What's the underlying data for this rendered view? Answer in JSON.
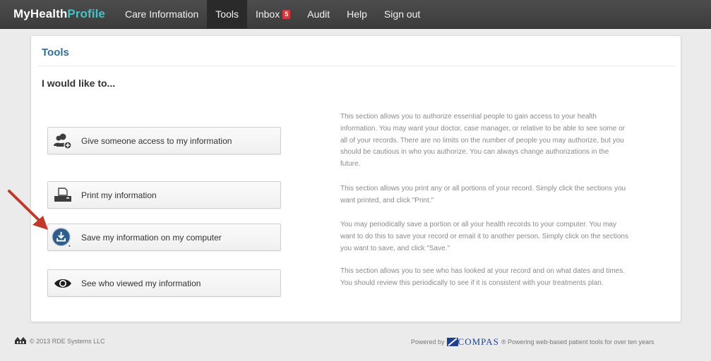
{
  "navbar": {
    "brand_main": "MyHealth",
    "brand_accent": "Profile",
    "items": [
      {
        "label": "Care Information"
      },
      {
        "label": "Tools",
        "active": true
      },
      {
        "label": "Inbox",
        "badge": "5"
      },
      {
        "label": "Audit"
      },
      {
        "label": "Help"
      },
      {
        "label": "Sign out"
      }
    ]
  },
  "panel": {
    "title": "Tools",
    "subheading": "I would like to..."
  },
  "actions": [
    {
      "label": "Give someone access to my information",
      "icon": "add-user-icon",
      "description": "This section allows you to authorize essential people to gain access to your health information. You may want your doctor, case manager, or relative to be able to see some or all of your records. There are no limits on the number of people you may authorize, but you should be cautious in who you authorize. You can always change authorizations in the future."
    },
    {
      "label": "Print my information",
      "icon": "printer-icon",
      "description": "This section allows you print any or all portions of your record. Simply click the sections you want printed, and click \"Print.\""
    },
    {
      "label": "Save my information on my computer",
      "icon": "download-icon",
      "description": "You may periodically save a portion or all your health records to your computer. You may want to do this to save your record or email it to another person. Simply click on the sections you want to save, and click \"Save.\""
    },
    {
      "label": "See who viewed my information",
      "icon": "eye-icon",
      "description": "This section allows you to see who has looked at your record and on what dates and times. You should review this periodically to see if it is consistent with your treatments plan."
    }
  ],
  "footer": {
    "copyright": "© 2013 RDE Systems LLC",
    "powered_by": "Powered by",
    "compas": "COMPAS",
    "tagline": "® Powering web-based patient tools for over ten years"
  },
  "colors": {
    "navbar": "#444444",
    "brand_accent": "#4cc0c4",
    "title": "#2f6f9a",
    "badge": "#d9363e",
    "arrow": "#c0392b",
    "download_icon": "#2e5f8a"
  }
}
